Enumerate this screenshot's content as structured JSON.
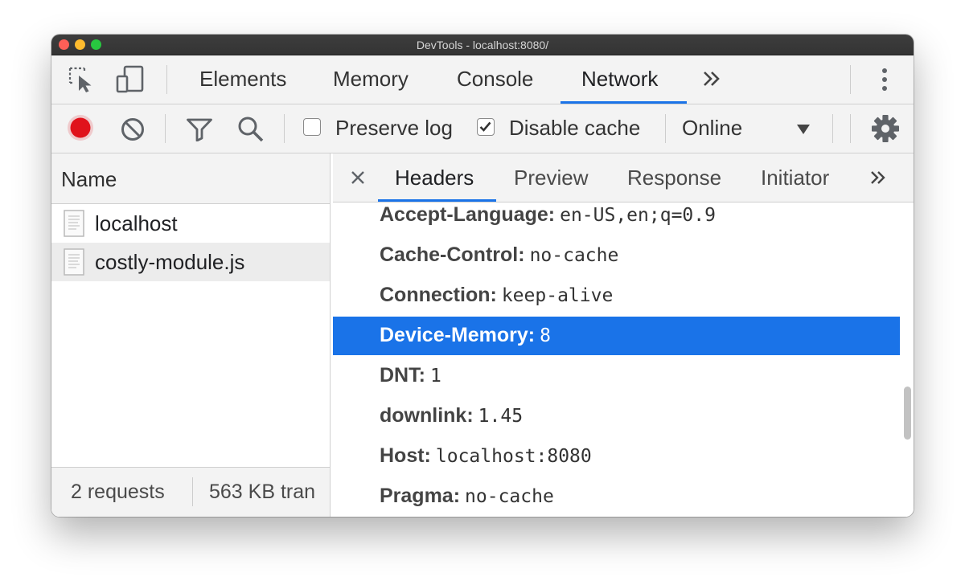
{
  "window": {
    "title": "DevTools - localhost:8080/"
  },
  "main_tabs": [
    {
      "label": "Elements"
    },
    {
      "label": "Memory"
    },
    {
      "label": "Console"
    },
    {
      "label": "Network",
      "active": true
    }
  ],
  "toolbar": {
    "preserve_log": {
      "label": "Preserve log",
      "checked": false
    },
    "disable_cache": {
      "label": "Disable cache",
      "checked": true
    },
    "throttling": {
      "value": "Online"
    }
  },
  "requests": {
    "column_name": "Name",
    "items": [
      {
        "name": "localhost",
        "selected": false
      },
      {
        "name": "costly-module.js",
        "selected": true
      }
    ],
    "summary": {
      "count": "2 requests",
      "transferred": "563 KB tran"
    }
  },
  "detail_tabs": [
    {
      "label": "Headers",
      "active": true
    },
    {
      "label": "Preview"
    },
    {
      "label": "Response"
    },
    {
      "label": "Initiator"
    }
  ],
  "headers": [
    {
      "name": "Accept-Language:",
      "value": "en-US,en;q=0.9"
    },
    {
      "name": "Cache-Control:",
      "value": "no-cache"
    },
    {
      "name": "Connection:",
      "value": "keep-alive"
    },
    {
      "name": "Device-Memory:",
      "value": "8",
      "selected": true
    },
    {
      "name": "DNT:",
      "value": "1"
    },
    {
      "name": "downlink:",
      "value": "1.45"
    },
    {
      "name": "Host:",
      "value": "localhost:8080"
    },
    {
      "name": "Pragma:",
      "value": "no-cache"
    }
  ],
  "icons": {
    "inspect": "inspect-element-icon",
    "device": "device-toolbar-icon",
    "more_tabs": "chevron-double-right-icon",
    "kebab": "more-vertical-icon",
    "record": "record-icon",
    "clear": "clear-icon",
    "filter": "filter-icon",
    "search": "search-icon",
    "dropdown": "dropdown-triangle-icon",
    "settings": "gear-icon",
    "close": "close-icon",
    "file": "document-icon"
  },
  "colors": {
    "accent": "#1a73e8",
    "record": "#e0121b",
    "toolbar_bg": "#f3f3f3",
    "selection": "#1a73e8"
  }
}
